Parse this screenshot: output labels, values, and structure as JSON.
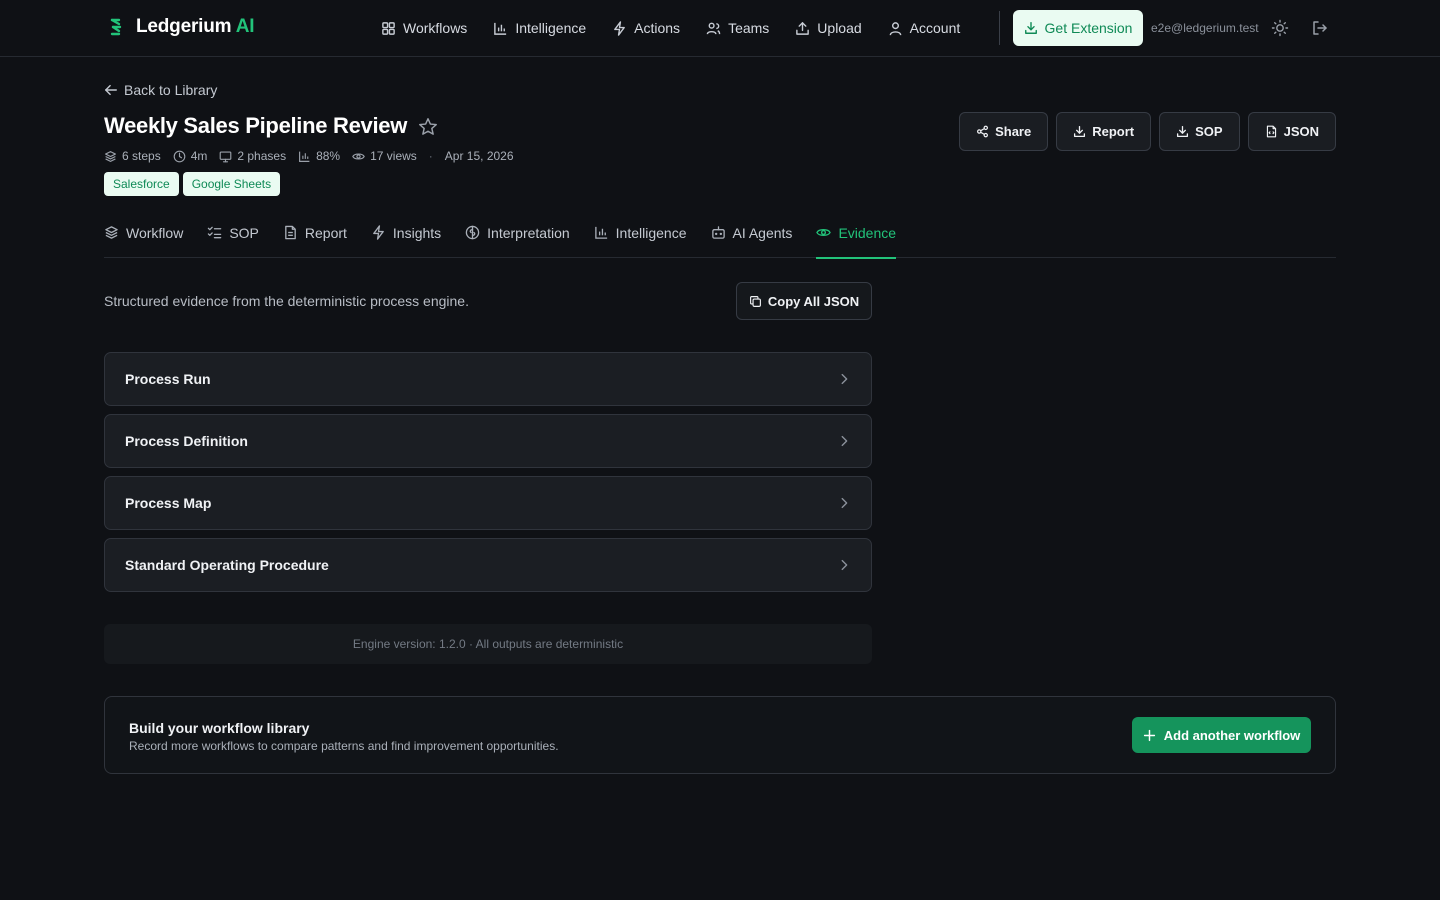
{
  "header": {
    "brand_name": "Ledgerium",
    "brand_suffix": "AI",
    "nav": [
      {
        "label": "Workflows",
        "icon": "grid-icon"
      },
      {
        "label": "Intelligence",
        "icon": "bar-chart-icon"
      },
      {
        "label": "Actions",
        "icon": "lightning-icon"
      },
      {
        "label": "Teams",
        "icon": "users-icon"
      },
      {
        "label": "Upload",
        "icon": "upload-icon"
      },
      {
        "label": "Account",
        "icon": "user-icon"
      }
    ],
    "get_extension_label": "Get Extension",
    "user_email": "e2e@ledgerium.test"
  },
  "back_label": "Back to Library",
  "workflow": {
    "title": "Weekly Sales Pipeline Review",
    "meta": {
      "steps": "6 steps",
      "duration": "4m",
      "phases": "2 phases",
      "score": "88%",
      "views": "17 views",
      "separator": "·",
      "date": "Apr 15, 2026"
    },
    "tags": [
      "Salesforce",
      "Google Sheets"
    ]
  },
  "actions": {
    "share": "Share",
    "report": "Report",
    "sop": "SOP",
    "json": "JSON"
  },
  "tabs": [
    {
      "label": "Workflow",
      "icon": "layers-icon"
    },
    {
      "label": "SOP",
      "icon": "checklist-icon"
    },
    {
      "label": "Report",
      "icon": "document-icon"
    },
    {
      "label": "Insights",
      "icon": "lightning-icon"
    },
    {
      "label": "Interpretation",
      "icon": "brain-icon"
    },
    {
      "label": "Intelligence",
      "icon": "bar-chart-icon"
    },
    {
      "label": "AI Agents",
      "icon": "bot-icon"
    },
    {
      "label": "Evidence",
      "icon": "eye-icon",
      "active": true
    }
  ],
  "evidence": {
    "description": "Structured evidence from the deterministic process engine.",
    "copy_label": "Copy All JSON",
    "panels": [
      "Process Run",
      "Process Definition",
      "Process Map",
      "Standard Operating Procedure"
    ],
    "engine_note": "Engine version: 1.2.0 · All outputs are deterministic"
  },
  "library": {
    "title": "Build your workflow library",
    "subtitle": "Record more workflows to compare patterns and find improvement opportunities.",
    "add_label": "Add another workflow"
  },
  "colors": {
    "accent": "#22c37a",
    "accent_button": "#15945c",
    "background": "#0f1115",
    "tag_bg": "#eafbf2"
  }
}
